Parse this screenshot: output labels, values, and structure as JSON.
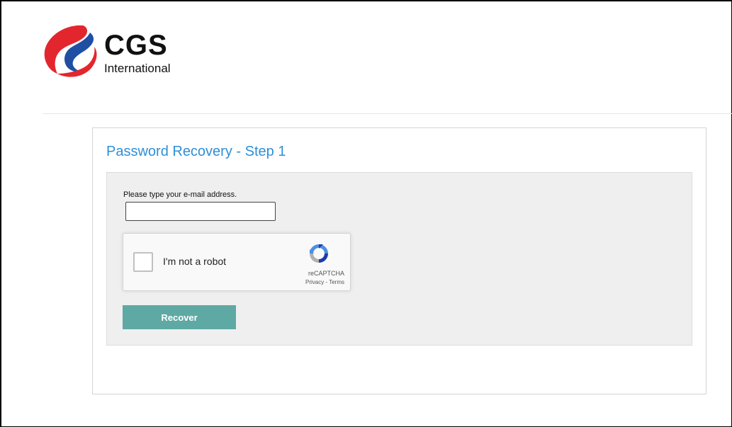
{
  "brand": {
    "name": "CGS",
    "subtitle": "International",
    "colors": {
      "red": "#e3262d",
      "blue": "#1f4fa3"
    }
  },
  "page": {
    "title": "Password Recovery - Step 1"
  },
  "form": {
    "email_label": "Please type your e-mail address.",
    "email_value": "",
    "submit_label": "Recover",
    "submit_color": "#5fa9a4"
  },
  "captcha": {
    "checkbox_label": "I'm not a robot",
    "checked": false,
    "brand_label": "reCAPTCHA",
    "privacy_label": "Privacy",
    "separator": " - ",
    "terms_label": "Terms",
    "icon": "recaptcha-icon"
  },
  "colors": {
    "title_blue": "#2e8fd8",
    "panel_bg": "#efefef",
    "button_teal": "#5fa9a4"
  }
}
